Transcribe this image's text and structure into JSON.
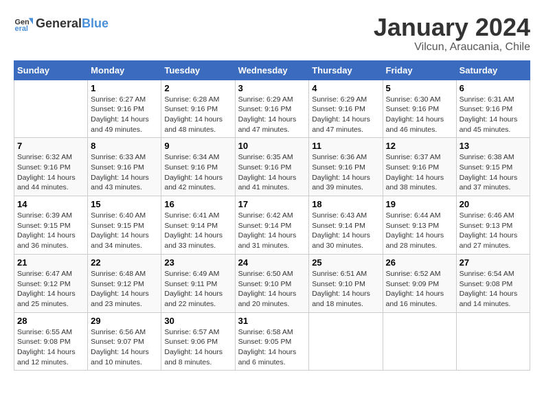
{
  "header": {
    "logo_general": "General",
    "logo_blue": "Blue",
    "title": "January 2024",
    "subtitle": "Vilcun, Araucania, Chile"
  },
  "days_of_week": [
    "Sunday",
    "Monday",
    "Tuesday",
    "Wednesday",
    "Thursday",
    "Friday",
    "Saturday"
  ],
  "weeks": [
    [
      {
        "day": "",
        "info": ""
      },
      {
        "day": "1",
        "info": "Sunrise: 6:27 AM\nSunset: 9:16 PM\nDaylight: 14 hours\nand 49 minutes."
      },
      {
        "day": "2",
        "info": "Sunrise: 6:28 AM\nSunset: 9:16 PM\nDaylight: 14 hours\nand 48 minutes."
      },
      {
        "day": "3",
        "info": "Sunrise: 6:29 AM\nSunset: 9:16 PM\nDaylight: 14 hours\nand 47 minutes."
      },
      {
        "day": "4",
        "info": "Sunrise: 6:29 AM\nSunset: 9:16 PM\nDaylight: 14 hours\nand 47 minutes."
      },
      {
        "day": "5",
        "info": "Sunrise: 6:30 AM\nSunset: 9:16 PM\nDaylight: 14 hours\nand 46 minutes."
      },
      {
        "day": "6",
        "info": "Sunrise: 6:31 AM\nSunset: 9:16 PM\nDaylight: 14 hours\nand 45 minutes."
      }
    ],
    [
      {
        "day": "7",
        "info": "Sunrise: 6:32 AM\nSunset: 9:16 PM\nDaylight: 14 hours\nand 44 minutes."
      },
      {
        "day": "8",
        "info": "Sunrise: 6:33 AM\nSunset: 9:16 PM\nDaylight: 14 hours\nand 43 minutes."
      },
      {
        "day": "9",
        "info": "Sunrise: 6:34 AM\nSunset: 9:16 PM\nDaylight: 14 hours\nand 42 minutes."
      },
      {
        "day": "10",
        "info": "Sunrise: 6:35 AM\nSunset: 9:16 PM\nDaylight: 14 hours\nand 41 minutes."
      },
      {
        "day": "11",
        "info": "Sunrise: 6:36 AM\nSunset: 9:16 PM\nDaylight: 14 hours\nand 39 minutes."
      },
      {
        "day": "12",
        "info": "Sunrise: 6:37 AM\nSunset: 9:16 PM\nDaylight: 14 hours\nand 38 minutes."
      },
      {
        "day": "13",
        "info": "Sunrise: 6:38 AM\nSunset: 9:15 PM\nDaylight: 14 hours\nand 37 minutes."
      }
    ],
    [
      {
        "day": "14",
        "info": "Sunrise: 6:39 AM\nSunset: 9:15 PM\nDaylight: 14 hours\nand 36 minutes."
      },
      {
        "day": "15",
        "info": "Sunrise: 6:40 AM\nSunset: 9:15 PM\nDaylight: 14 hours\nand 34 minutes."
      },
      {
        "day": "16",
        "info": "Sunrise: 6:41 AM\nSunset: 9:14 PM\nDaylight: 14 hours\nand 33 minutes."
      },
      {
        "day": "17",
        "info": "Sunrise: 6:42 AM\nSunset: 9:14 PM\nDaylight: 14 hours\nand 31 minutes."
      },
      {
        "day": "18",
        "info": "Sunrise: 6:43 AM\nSunset: 9:14 PM\nDaylight: 14 hours\nand 30 minutes."
      },
      {
        "day": "19",
        "info": "Sunrise: 6:44 AM\nSunset: 9:13 PM\nDaylight: 14 hours\nand 28 minutes."
      },
      {
        "day": "20",
        "info": "Sunrise: 6:46 AM\nSunset: 9:13 PM\nDaylight: 14 hours\nand 27 minutes."
      }
    ],
    [
      {
        "day": "21",
        "info": "Sunrise: 6:47 AM\nSunset: 9:12 PM\nDaylight: 14 hours\nand 25 minutes."
      },
      {
        "day": "22",
        "info": "Sunrise: 6:48 AM\nSunset: 9:12 PM\nDaylight: 14 hours\nand 23 minutes."
      },
      {
        "day": "23",
        "info": "Sunrise: 6:49 AM\nSunset: 9:11 PM\nDaylight: 14 hours\nand 22 minutes."
      },
      {
        "day": "24",
        "info": "Sunrise: 6:50 AM\nSunset: 9:10 PM\nDaylight: 14 hours\nand 20 minutes."
      },
      {
        "day": "25",
        "info": "Sunrise: 6:51 AM\nSunset: 9:10 PM\nDaylight: 14 hours\nand 18 minutes."
      },
      {
        "day": "26",
        "info": "Sunrise: 6:52 AM\nSunset: 9:09 PM\nDaylight: 14 hours\nand 16 minutes."
      },
      {
        "day": "27",
        "info": "Sunrise: 6:54 AM\nSunset: 9:08 PM\nDaylight: 14 hours\nand 14 minutes."
      }
    ],
    [
      {
        "day": "28",
        "info": "Sunrise: 6:55 AM\nSunset: 9:08 PM\nDaylight: 14 hours\nand 12 minutes."
      },
      {
        "day": "29",
        "info": "Sunrise: 6:56 AM\nSunset: 9:07 PM\nDaylight: 14 hours\nand 10 minutes."
      },
      {
        "day": "30",
        "info": "Sunrise: 6:57 AM\nSunset: 9:06 PM\nDaylight: 14 hours\nand 8 minutes."
      },
      {
        "day": "31",
        "info": "Sunrise: 6:58 AM\nSunset: 9:05 PM\nDaylight: 14 hours\nand 6 minutes."
      },
      {
        "day": "",
        "info": ""
      },
      {
        "day": "",
        "info": ""
      },
      {
        "day": "",
        "info": ""
      }
    ]
  ]
}
